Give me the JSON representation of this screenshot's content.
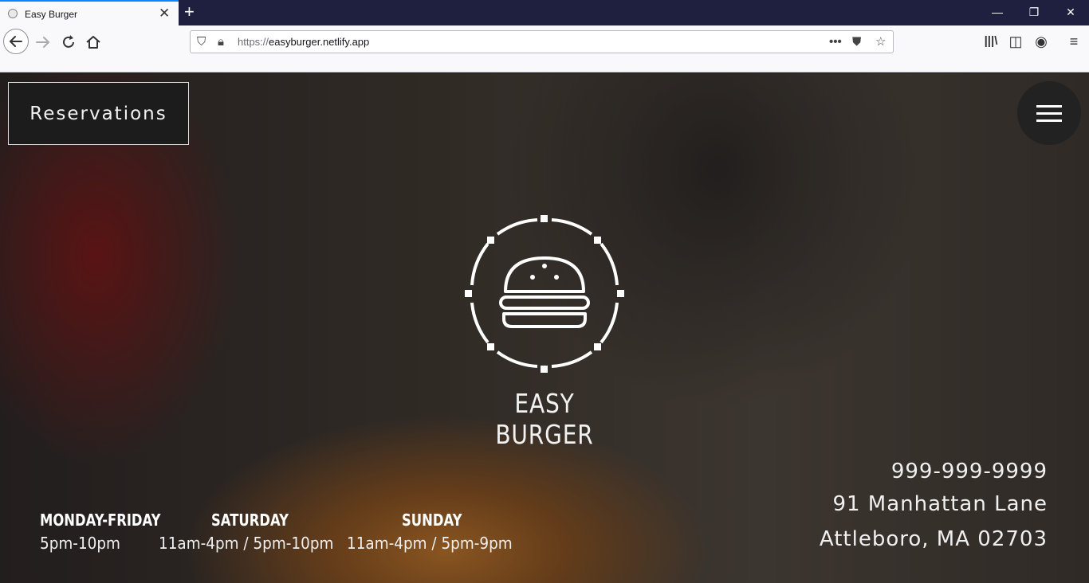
{
  "browser": {
    "tab_title": "Easy Burger",
    "url_scheme": "https://",
    "url_host": "easyburger.netlify.app"
  },
  "site": {
    "reservations_label": "Reservations",
    "brand_name": "EASY BURGER",
    "hours": [
      {
        "day": "MONDAY-FRIDAY",
        "time": "5pm-10pm"
      },
      {
        "day": "SATURDAY",
        "time": "11am-4pm / 5pm-10pm"
      },
      {
        "day": "SUNDAY",
        "time": "11am-4pm / 5pm-9pm"
      }
    ],
    "phone": "999-999-9999",
    "address_line1": "91 Manhattan Lane",
    "address_line2": "Attleboro, MA 02703"
  }
}
